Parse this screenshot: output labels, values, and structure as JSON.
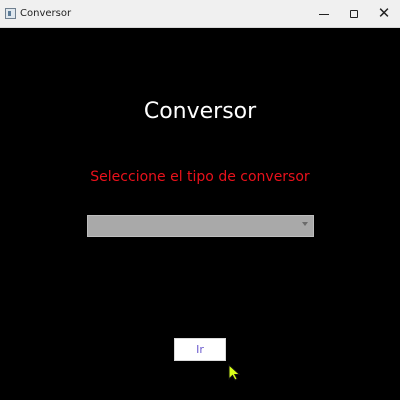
{
  "window": {
    "title": "Conversor",
    "controls": {
      "minimize": "minimize-icon",
      "maximize": "maximize-icon",
      "close": "close-icon"
    }
  },
  "main": {
    "heading": "Conversor",
    "subtitle": "Seleccione el tipo de conversor",
    "converter_select": {
      "value": ""
    },
    "action_button": "Ir"
  },
  "colors": {
    "background": "#000000",
    "heading": "#ffffff",
    "subtitle": "#e8111b",
    "select_fill": "#a9a9a9",
    "button_text": "#6a5acd",
    "cursor_fill": "#d8ff18"
  }
}
